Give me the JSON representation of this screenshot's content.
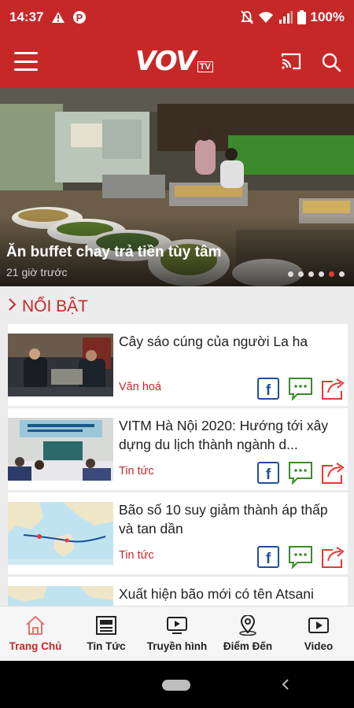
{
  "status_bar": {
    "time": "14:37",
    "battery": "100%",
    "left_icons": [
      "alert-triangle-icon",
      "parking-icon"
    ],
    "right_icons": [
      "bell-off-icon",
      "wifi-icon",
      "signal-icon",
      "battery-icon"
    ]
  },
  "app_bar": {
    "logo_text": "VOV",
    "logo_badge": "TV",
    "icons": [
      "menu-icon",
      "cast-icon",
      "search-icon"
    ],
    "color": "#c62828"
  },
  "hero": {
    "title": "Ăn buffet chay trả tiền tùy tâm",
    "time": "21 giờ trước",
    "slide_count": 6,
    "active_slide": 4
  },
  "section": {
    "title": "NỔI BẬT"
  },
  "articles": [
    {
      "title": "Cây sáo cúng của người La ha",
      "category": "Văn hoá"
    },
    {
      "title": "VITM Hà Nội 2020: Hướng tới xây dựng du lịch thành ngành d...",
      "category": "Tin tức"
    },
    {
      "title": "Bão số 10 suy giảm thành áp thấp và tan dần",
      "category": "Tin tức"
    },
    {
      "title": "Xuất hiện bão mới có tên Atsani",
      "category": ""
    }
  ],
  "bottom_nav": [
    {
      "label": "Trang Chủ",
      "icon": "home-icon",
      "active": true
    },
    {
      "label": "Tin Tức",
      "icon": "newspaper-icon",
      "active": false
    },
    {
      "label": "Truyền hình",
      "icon": "tv-icon",
      "active": false
    },
    {
      "label": "Điểm Đến",
      "icon": "map-pin-icon",
      "active": false
    },
    {
      "label": "Video",
      "icon": "video-icon",
      "active": false
    }
  ]
}
